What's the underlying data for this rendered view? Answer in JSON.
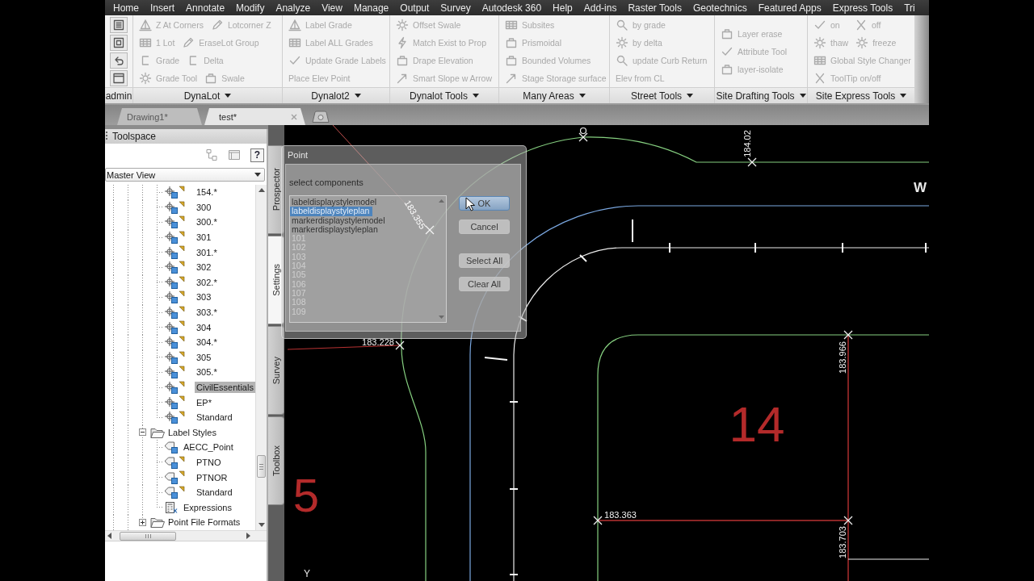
{
  "menu_tabs": [
    "Home",
    "Insert",
    "Annotate",
    "Modify",
    "Analyze",
    "View",
    "Manage",
    "Output",
    "Survey",
    "Autodesk 360",
    "Help",
    "Add-ins",
    "Raster Tools",
    "Geotechnics",
    "Featured Apps",
    "Express Tools",
    "Tri"
  ],
  "ribbon": {
    "panels": [
      {
        "title": "admin",
        "menu": false,
        "rows": [
          [
            {
              "kind": "icon",
              "disabled": false
            }
          ],
          [
            {
              "kind": "icon",
              "disabled": false
            }
          ],
          [
            {
              "kind": "icon",
              "disabled": false
            }
          ],
          [
            {
              "kind": "icon",
              "disabled": false
            }
          ]
        ]
      },
      {
        "title": "DynaLot",
        "menu": true,
        "rows": [
          [
            {
              "kind": "icon_text",
              "label": "Z At Corners",
              "disabled": true
            },
            {
              "kind": "icon_text",
              "label": "Lotcorner Z",
              "disabled": true
            }
          ],
          [
            {
              "kind": "icon_text",
              "label": "1 Lot",
              "disabled": true
            },
            {
              "kind": "icon_text",
              "label": "EraseLot Group",
              "disabled": true
            }
          ],
          [
            {
              "kind": "icon_text",
              "label": "Grade",
              "disabled": true
            },
            {
              "kind": "icon_text",
              "label": "Delta",
              "disabled": true
            }
          ],
          [
            {
              "kind": "icon_text",
              "label": "Grade Tool",
              "disabled": true
            },
            {
              "kind": "icon_text",
              "label": "Swale",
              "disabled": true
            }
          ]
        ]
      },
      {
        "title": "Dynalot2",
        "menu": true,
        "rows": [
          [
            {
              "kind": "icon_text",
              "label": "Label Grade",
              "disabled": true
            }
          ],
          [
            {
              "kind": "icon_text",
              "label": "Label ALL Grades",
              "disabled": true
            }
          ],
          [
            {
              "kind": "icon_text",
              "label": "Update Grade Labels",
              "disabled": true
            }
          ],
          [
            {
              "kind": "text",
              "label": "Place Elev Point",
              "disabled": true
            }
          ]
        ]
      },
      {
        "title": "Dynalot Tools",
        "menu": true,
        "rows": [
          [
            {
              "kind": "icon_text",
              "label": "Offset Swale",
              "disabled": true
            }
          ],
          [
            {
              "kind": "icon_text",
              "label": "Match Exist to Prop",
              "disabled": true
            }
          ],
          [
            {
              "kind": "icon_text",
              "label": "Drape Elevation",
              "disabled": true
            }
          ],
          [
            {
              "kind": "icon_text",
              "label": "Smart Slope w Arrow",
              "disabled": true
            }
          ]
        ]
      },
      {
        "title": "Many Areas",
        "menu": true,
        "rows": [
          [
            {
              "kind": "icon_text",
              "label": "Subsites",
              "disabled": true
            }
          ],
          [
            {
              "kind": "icon_text",
              "label": "Prismoidal",
              "disabled": true
            }
          ],
          [
            {
              "kind": "icon_text",
              "label": "Bounded Volumes",
              "disabled": true
            }
          ],
          [
            {
              "kind": "icon_text",
              "label": "Stage Storage surface",
              "disabled": true
            }
          ]
        ]
      },
      {
        "title": "Street Tools",
        "menu": true,
        "rows": [
          [
            {
              "kind": "icon_text",
              "label": "by grade",
              "disabled": true
            }
          ],
          [
            {
              "kind": "icon_text",
              "label": "by delta",
              "disabled": true
            }
          ],
          [
            {
              "kind": "icon_text",
              "label": "update Curb Return",
              "disabled": true
            }
          ],
          [
            {
              "kind": "text",
              "label": "Elev from CL",
              "disabled": true
            }
          ]
        ]
      },
      {
        "title": "Site Drafting Tools",
        "menu": true,
        "rows": [
          [
            {
              "kind": "icon_text",
              "label": "Layer erase",
              "disabled": true
            }
          ],
          [
            {
              "kind": "icon_text",
              "label": "Attribute Tool",
              "disabled": true
            }
          ],
          [
            {
              "kind": "icon_text",
              "label": "layer-isolate",
              "disabled": true
            }
          ]
        ]
      },
      {
        "title": "Site Express Tools",
        "menu": true,
        "rows": [
          [
            {
              "kind": "icon_text",
              "label": "on",
              "disabled": true
            },
            {
              "kind": "icon_text",
              "label": "off",
              "disabled": true
            }
          ],
          [
            {
              "kind": "icon_text",
              "label": "thaw",
              "disabled": true
            },
            {
              "kind": "icon_text",
              "label": "freeze",
              "disabled": true
            }
          ],
          [
            {
              "kind": "icon_text",
              "label": "Global Style Changer",
              "disabled": true
            }
          ],
          [
            {
              "kind": "icon_text",
              "label": "ToolTip on/off",
              "disabled": true
            }
          ]
        ]
      }
    ]
  },
  "document_tabs": [
    {
      "label": "Drawing1*",
      "selected": false
    },
    {
      "label": "test*",
      "selected": true
    }
  ],
  "toolspace": {
    "title": "Toolspace",
    "help_label": "?",
    "view": "Master View",
    "tree": {
      "continued_items": [
        {
          "label": "154.*",
          "kind": "marker_style",
          "in_use": true,
          "selected": false
        },
        {
          "label": "300",
          "kind": "marker_style",
          "in_use": true,
          "selected": false
        },
        {
          "label": "300.*",
          "kind": "marker_style",
          "in_use": true,
          "selected": false
        },
        {
          "label": "301",
          "kind": "marker_style",
          "in_use": true,
          "selected": false
        },
        {
          "label": "301.*",
          "kind": "marker_style",
          "in_use": true,
          "selected": false
        },
        {
          "label": "302",
          "kind": "marker_style",
          "in_use": true,
          "selected": false
        },
        {
          "label": "302.*",
          "kind": "marker_style",
          "in_use": true,
          "selected": false
        },
        {
          "label": "303",
          "kind": "marker_style",
          "in_use": true,
          "selected": false
        },
        {
          "label": "303.*",
          "kind": "marker_style",
          "in_use": true,
          "selected": false
        },
        {
          "label": "304",
          "kind": "marker_style",
          "in_use": true,
          "selected": false
        },
        {
          "label": "304.*",
          "kind": "marker_style",
          "in_use": true,
          "selected": false
        },
        {
          "label": "305",
          "kind": "marker_style",
          "in_use": true,
          "selected": false
        },
        {
          "label": "305.*",
          "kind": "marker_style",
          "in_use": true,
          "selected": false
        },
        {
          "label": "CivilEssentials",
          "kind": "marker_style",
          "in_use": true,
          "selected": true
        },
        {
          "label": "EP*",
          "kind": "marker_style",
          "in_use": true,
          "selected": false
        },
        {
          "label": "Standard",
          "kind": "marker_style",
          "in_use": true,
          "selected": false
        }
      ],
      "nodes": [
        {
          "label": "Label Styles",
          "kind": "folder",
          "expanded": true,
          "selected": false,
          "children": [
            {
              "label": "AECC_Point",
              "kind": "label_style",
              "in_use": false,
              "selected": false
            },
            {
              "label": "PTNO",
              "kind": "label_style",
              "in_use": true,
              "selected": false
            },
            {
              "label": "PTNOR",
              "kind": "label_style",
              "in_use": true,
              "selected": false
            },
            {
              "label": "Standard",
              "kind": "label_style",
              "in_use": true,
              "selected": false
            },
            {
              "label": "Expressions",
              "kind": "expressions",
              "in_use": false,
              "selected": false
            }
          ]
        },
        {
          "label": "Point File Formats",
          "kind": "folder",
          "expanded": false,
          "selected": false
        }
      ]
    },
    "side_tabs": [
      {
        "label": "Prospector",
        "selected": false
      },
      {
        "label": "Settings",
        "selected": true
      },
      {
        "label": "Survey",
        "selected": false
      },
      {
        "label": "Toolbox",
        "selected": false
      }
    ]
  },
  "dialog": {
    "title": "Point",
    "prompt": "select components",
    "items": [
      {
        "text": "labeldisplaystylemodel",
        "selected": false,
        "faded": false
      },
      {
        "text": "labeldisplaystyleplan",
        "selected": true,
        "faded": false
      },
      {
        "text": "markerdisplaystylemodel",
        "selected": false,
        "faded": false
      },
      {
        "text": "markerdisplaystyleplan",
        "selected": false,
        "faded": false
      },
      {
        "text": "101",
        "selected": false,
        "faded": true
      },
      {
        "text": "102",
        "selected": false,
        "faded": true
      },
      {
        "text": "103",
        "selected": false,
        "faded": true
      },
      {
        "text": "104",
        "selected": false,
        "faded": true
      },
      {
        "text": "105",
        "selected": false,
        "faded": true
      },
      {
        "text": "106",
        "selected": false,
        "faded": true
      },
      {
        "text": "107",
        "selected": false,
        "faded": true
      },
      {
        "text": "108",
        "selected": false,
        "faded": true
      },
      {
        "text": "109",
        "selected": false,
        "faded": true
      }
    ],
    "buttons": [
      {
        "label": "OK",
        "focused": true
      },
      {
        "label": "Cancel",
        "focused": false
      },
      {
        "label": "Select All",
        "focused": false
      },
      {
        "label": "Clear All",
        "focused": false
      }
    ]
  },
  "drawing": {
    "elevation_labels": [
      "184.02",
      "183.355",
      "183.228",
      "183.966",
      "183.363",
      "183.703"
    ],
    "lot_numbers": [
      "14",
      "5"
    ],
    "compass_letter": "W",
    "axis_label": "Y"
  }
}
